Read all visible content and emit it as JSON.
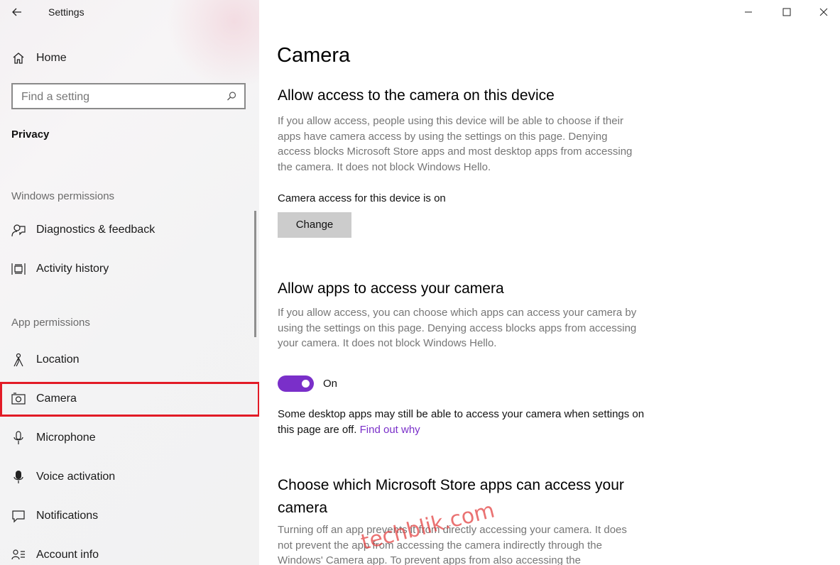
{
  "window": {
    "app_title": "Settings"
  },
  "sidebar": {
    "home_label": "Home",
    "search_placeholder": "Find a setting",
    "section_title": "Privacy",
    "windows_permissions_title": "Windows permissions",
    "windows_permissions": [
      {
        "label": "Diagnostics & feedback",
        "icon": "diagnostics-icon"
      },
      {
        "label": "Activity history",
        "icon": "activity-history-icon"
      }
    ],
    "app_permissions_title": "App permissions",
    "app_permissions": [
      {
        "label": "Location",
        "icon": "location-icon"
      },
      {
        "label": "Camera",
        "icon": "camera-icon",
        "selected": true
      },
      {
        "label": "Microphone",
        "icon": "microphone-icon"
      },
      {
        "label": "Voice activation",
        "icon": "voice-activation-icon"
      },
      {
        "label": "Notifications",
        "icon": "notifications-icon"
      },
      {
        "label": "Account info",
        "icon": "account-info-icon"
      }
    ]
  },
  "main": {
    "page_title": "Camera",
    "device_section": {
      "heading": "Allow access to the camera on this device",
      "description": "If you allow access, people using this device will be able to choose if their apps have camera access by using the settings on this page. Denying access blocks Microsoft Store apps and most desktop apps from accessing the camera. It does not block Windows Hello.",
      "status": "Camera access for this device is on",
      "change_label": "Change"
    },
    "apps_section": {
      "heading": "Allow apps to access your camera",
      "description": "If you allow access, you can choose which apps can access your camera by using the settings on this page. Denying access blocks apps from accessing your camera. It does not block Windows Hello.",
      "toggle_state": "On",
      "note": "Some desktop apps may still be able to access your camera when settings on this page are off.",
      "link": "Find out why"
    },
    "store_section": {
      "heading": "Choose which Microsoft Store apps can access your camera",
      "description": "Turning off an app prevents it from directly accessing your camera. It does not prevent the app from accessing the camera indirectly through the Windows' Camera app. To prevent apps from also accessing the"
    }
  },
  "watermark": "techblik.com",
  "colors": {
    "accent": "#7a2fc9",
    "highlight_border": "#e21b26",
    "button_bg": "#cccccc"
  }
}
